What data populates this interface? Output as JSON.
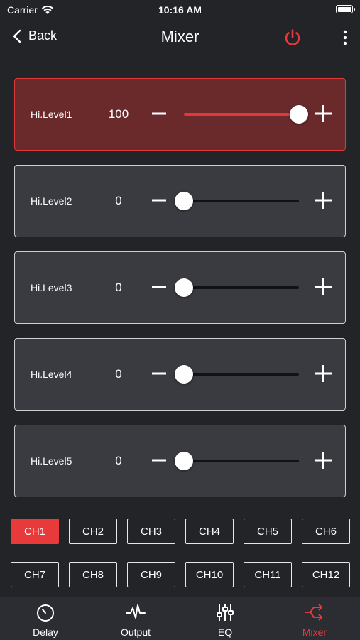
{
  "status_bar": {
    "carrier": "Carrier",
    "time": "10:16 AM"
  },
  "nav": {
    "back_label": "Back",
    "title": "Mixer"
  },
  "channels": [
    {
      "label": "Hi.Level1",
      "value": "100",
      "level_percent": 100,
      "active": true
    },
    {
      "label": "Hi.Level2",
      "value": "0",
      "level_percent": 0,
      "active": false
    },
    {
      "label": "Hi.Level3",
      "value": "0",
      "level_percent": 0,
      "active": false
    },
    {
      "label": "Hi.Level4",
      "value": "0",
      "level_percent": 0,
      "active": false
    },
    {
      "label": "Hi.Level5",
      "value": "0",
      "level_percent": 0,
      "active": false
    }
  ],
  "ch_buttons": [
    "CH1",
    "CH2",
    "CH3",
    "CH4",
    "CH5",
    "CH6",
    "CH7",
    "CH8",
    "CH9",
    "CH10",
    "CH11",
    "CH12"
  ],
  "selected_ch": "CH1",
  "tabs": [
    {
      "label": "Delay",
      "icon": "stopwatch-icon"
    },
    {
      "label": "Output",
      "icon": "waveform-icon"
    },
    {
      "label": "EQ",
      "icon": "sliders-icon"
    },
    {
      "label": "Mixer",
      "icon": "shuffle-icon",
      "active": true
    }
  ],
  "colors": {
    "accent": "#e8393b",
    "background": "#232428",
    "card": "#3a3b40",
    "active_card": "#6a2a2b"
  }
}
